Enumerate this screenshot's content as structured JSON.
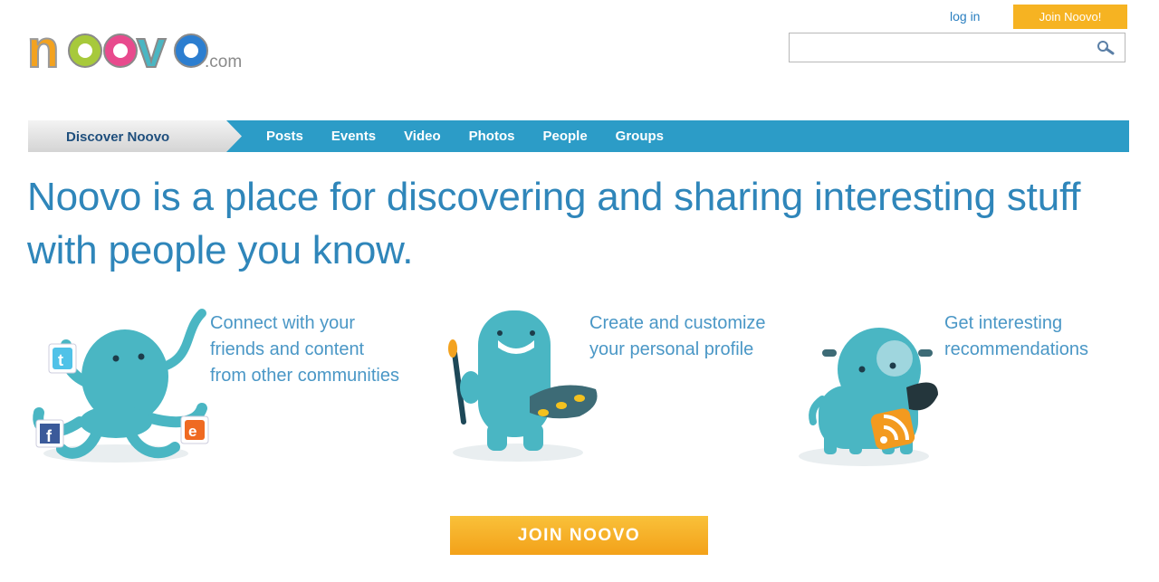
{
  "header": {
    "logo_alt": "noovo.com",
    "login_label": "log in",
    "join_label": "Join Noovo!",
    "search": {
      "value": "",
      "placeholder": ""
    }
  },
  "nav": {
    "discover_label": "Discover Noovo",
    "items": [
      {
        "label": "Posts"
      },
      {
        "label": "Events"
      },
      {
        "label": "Video"
      },
      {
        "label": "Photos"
      },
      {
        "label": "People"
      },
      {
        "label": "Groups"
      }
    ]
  },
  "headline": "Noovo is a place for discovering and sharing interesting stuff with people you know.",
  "features": [
    {
      "lines": [
        "Connect with your",
        "friends and content",
        "from other communities"
      ],
      "icon": "octopus-icon"
    },
    {
      "lines": [
        "Create and customize",
        "your personal profile"
      ],
      "icon": "painter-monster-icon"
    },
    {
      "lines": [
        "Get interesting",
        "recommendations"
      ],
      "icon": "dog-rss-icon"
    }
  ],
  "cta": {
    "label": "JOIN NOOVO"
  },
  "colors": {
    "brand_blue": "#2c9cc7",
    "cta_orange": "#f6b322",
    "text_blue": "#4a97c6",
    "mascot_teal": "#4ab6c3"
  }
}
